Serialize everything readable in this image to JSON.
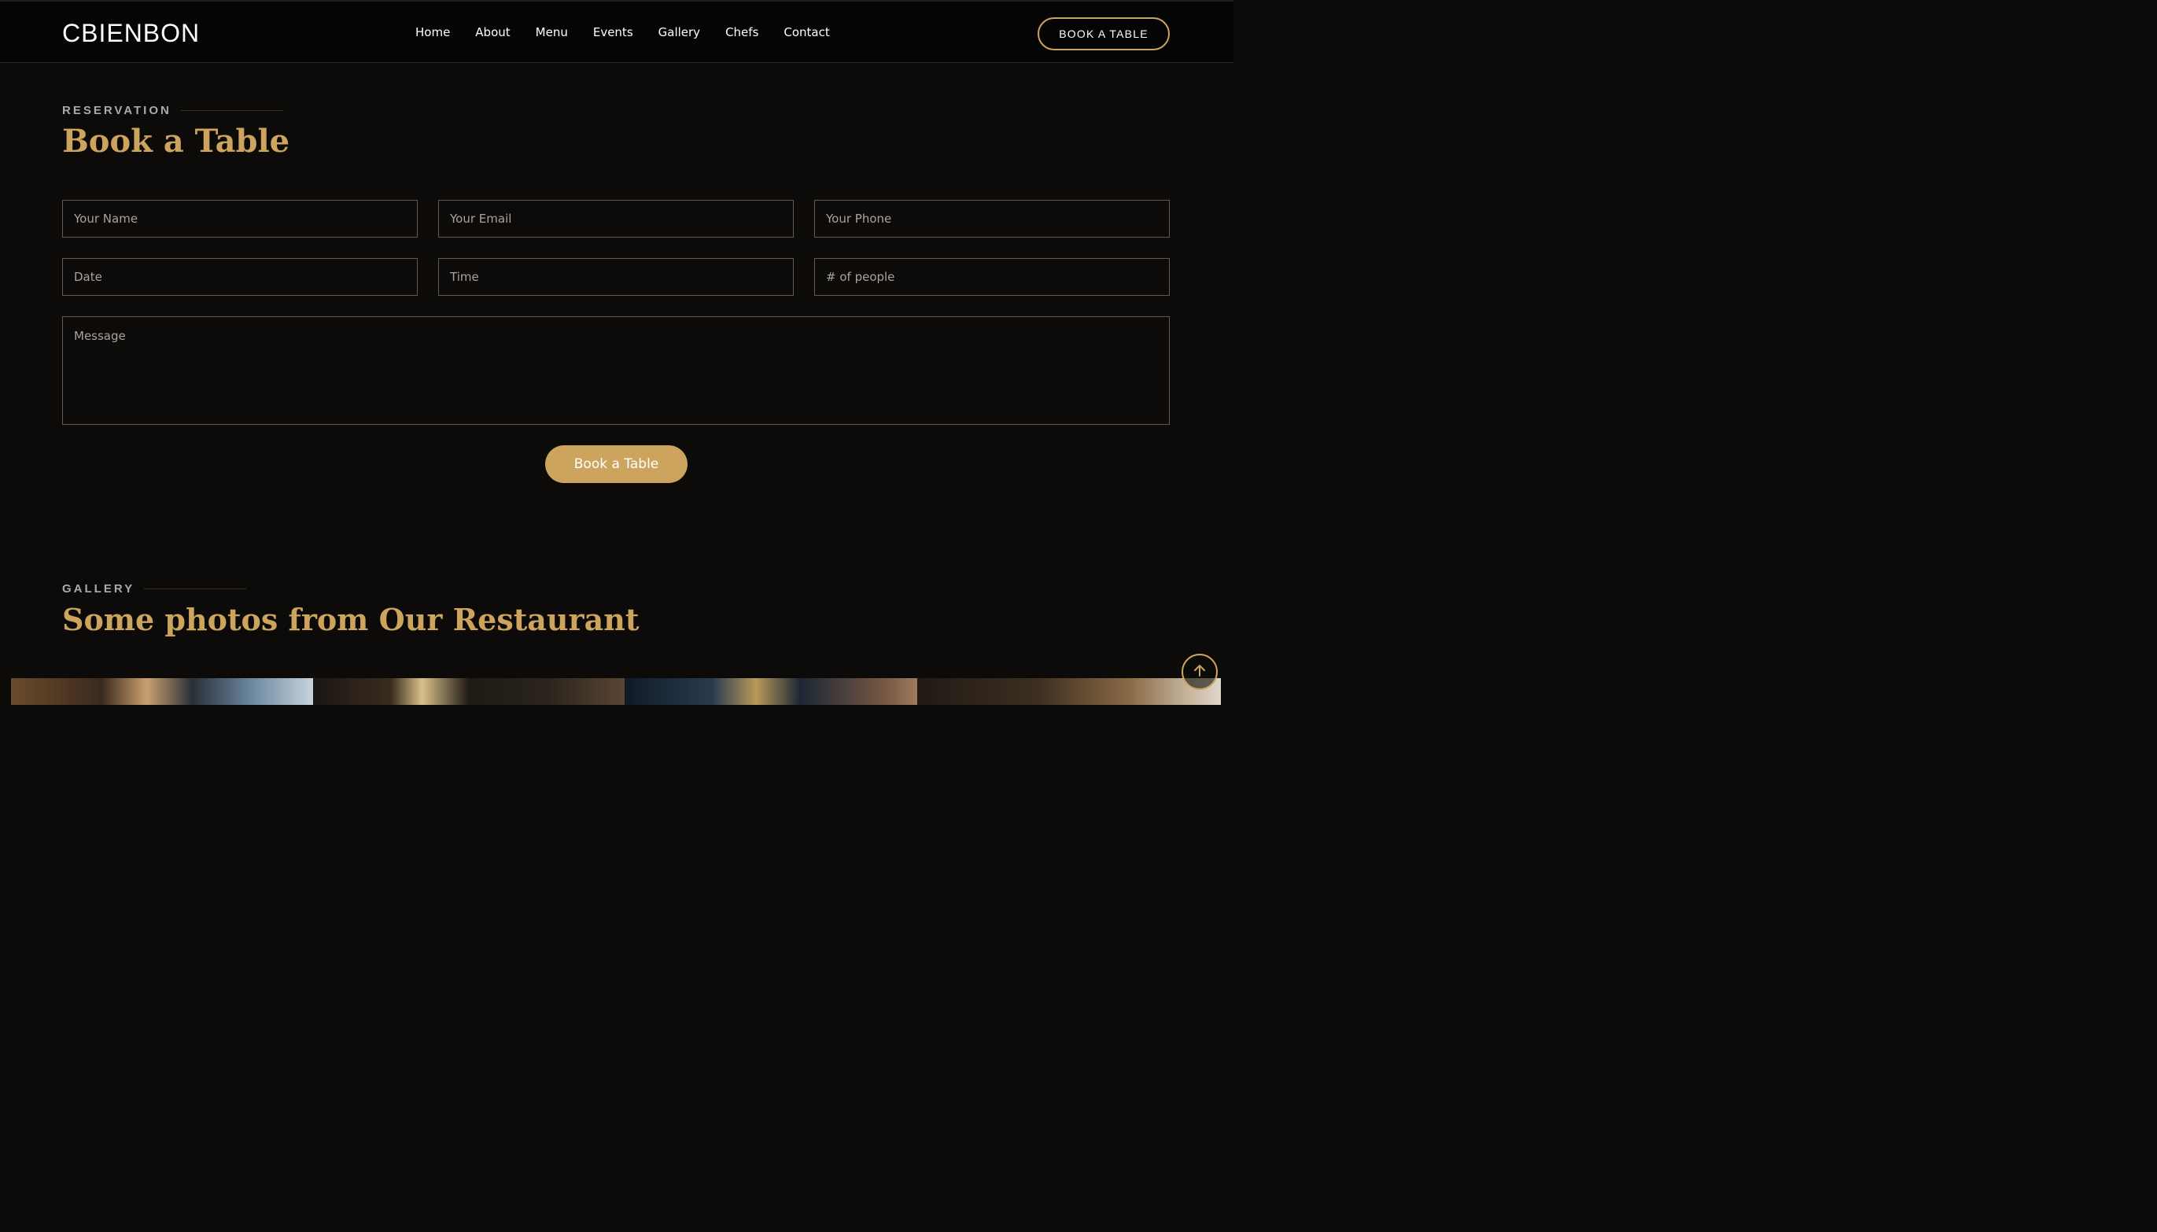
{
  "header": {
    "logo": "CBIENBON",
    "nav": [
      "Home",
      "About",
      "Menu",
      "Events",
      "Gallery",
      "Chefs",
      "Contact"
    ],
    "cta_label": "BOOK A TABLE"
  },
  "reservation": {
    "label": "RESERVATION",
    "title": "Book a Table",
    "fields": {
      "name_placeholder": "Your Name",
      "email_placeholder": "Your Email",
      "phone_placeholder": "Your Phone",
      "date_placeholder": "Date",
      "time_placeholder": "Time",
      "people_placeholder": "# of people",
      "message_placeholder": "Message"
    },
    "submit_label": "Book a Table"
  },
  "gallery": {
    "label": "GALLERY",
    "title": "Some photos from Our Restaurant"
  },
  "back_to_top_icon": "arrow-up-icon",
  "colors": {
    "accent": "#cda45e",
    "background": "#0c0b09",
    "header_background": "#050505"
  }
}
